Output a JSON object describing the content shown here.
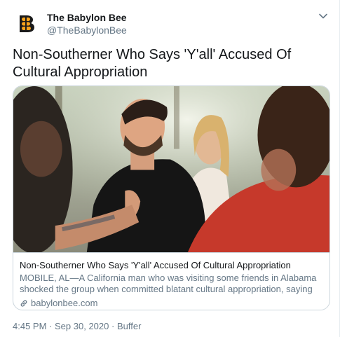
{
  "account": {
    "display_name": "The Babylon Bee",
    "handle": "@TheBabylonBee",
    "avatar_icon": "babylon-bee-logo",
    "brand_color": "#f7a21b"
  },
  "tweet": {
    "text": "Non-Southerner Who Says 'Y'all' Accused Of Cultural Appropriation"
  },
  "card": {
    "title": "Non-Southerner Who Says 'Y'all' Accused Of Cultural Appropriation",
    "description": "MOBILE, AL—A California man who was visiting some friends in Alabama shocked the group when committed blatant cultural appropriation, saying the word \"y'all...",
    "domain": "babylonbee.com",
    "link_icon": "link-icon"
  },
  "meta": {
    "time": "4:45 PM",
    "separator": "·",
    "date": "Sep 30, 2020",
    "source": "Buffer"
  },
  "menu_icon": "chevron-down-icon"
}
